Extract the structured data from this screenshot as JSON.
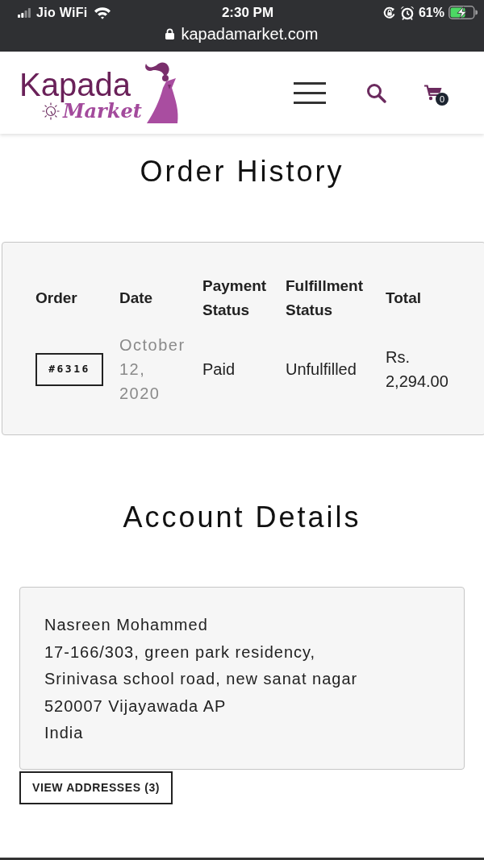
{
  "status_bar": {
    "carrier": "Jio WiFi",
    "time": "2:30 PM",
    "battery": "61%"
  },
  "browser": {
    "url": "kapadamarket.com"
  },
  "header": {
    "logo": {
      "line_1": "Kapada",
      "line_2": "Market"
    },
    "cart_count": "0"
  },
  "order_history": {
    "title": "Order History",
    "columns": [
      "Order",
      "Date",
      "Payment Status",
      "Fulfillment Status",
      "Total"
    ],
    "rows": [
      {
        "order": "#6316",
        "date": "October 12, 2020",
        "payment_status": "Paid",
        "fulfillment_status": "Unfulfilled",
        "total": "Rs. 2,294.00"
      }
    ]
  },
  "account_details": {
    "title": "Account Details",
    "address_lines": [
      "Nasreen Mohammed",
      "17-166/303, green park residency,",
      "Srinivasa school road, new sanat nagar",
      "520007 Vijayawada AP",
      "India"
    ],
    "button": "VIEW ADDRESSES (3)"
  }
}
